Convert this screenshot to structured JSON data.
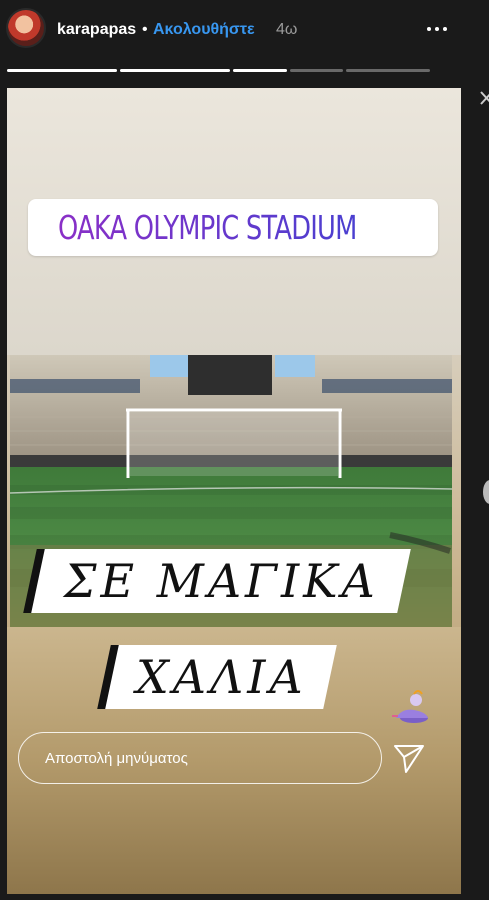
{
  "header": {
    "username": "karapapas",
    "separator": "•",
    "follow_label": "Ακολουθήστε",
    "time": "4ω",
    "more_icon": "more-dots-icon"
  },
  "progress": {
    "total_segments": 5,
    "completed_segments": 3
  },
  "story": {
    "location_sticker": {
      "icon": "location-pin-icon",
      "label": "OAKA OLYMPIC STADIUM",
      "colors": [
        "#8a2fc7",
        "#4a3fd0"
      ]
    },
    "caption_line1": "ΣΕ ΜΑΓΙΚΑ",
    "caption_line2": "ΧΑΛΙΑ",
    "genie_sticker": "genie-lamp-icon"
  },
  "reply": {
    "placeholder": "Αποστολή μηνύματος",
    "send_icon": "send-icon"
  },
  "colors": {
    "accent": "#3897f0",
    "background": "#1a1a1a"
  }
}
